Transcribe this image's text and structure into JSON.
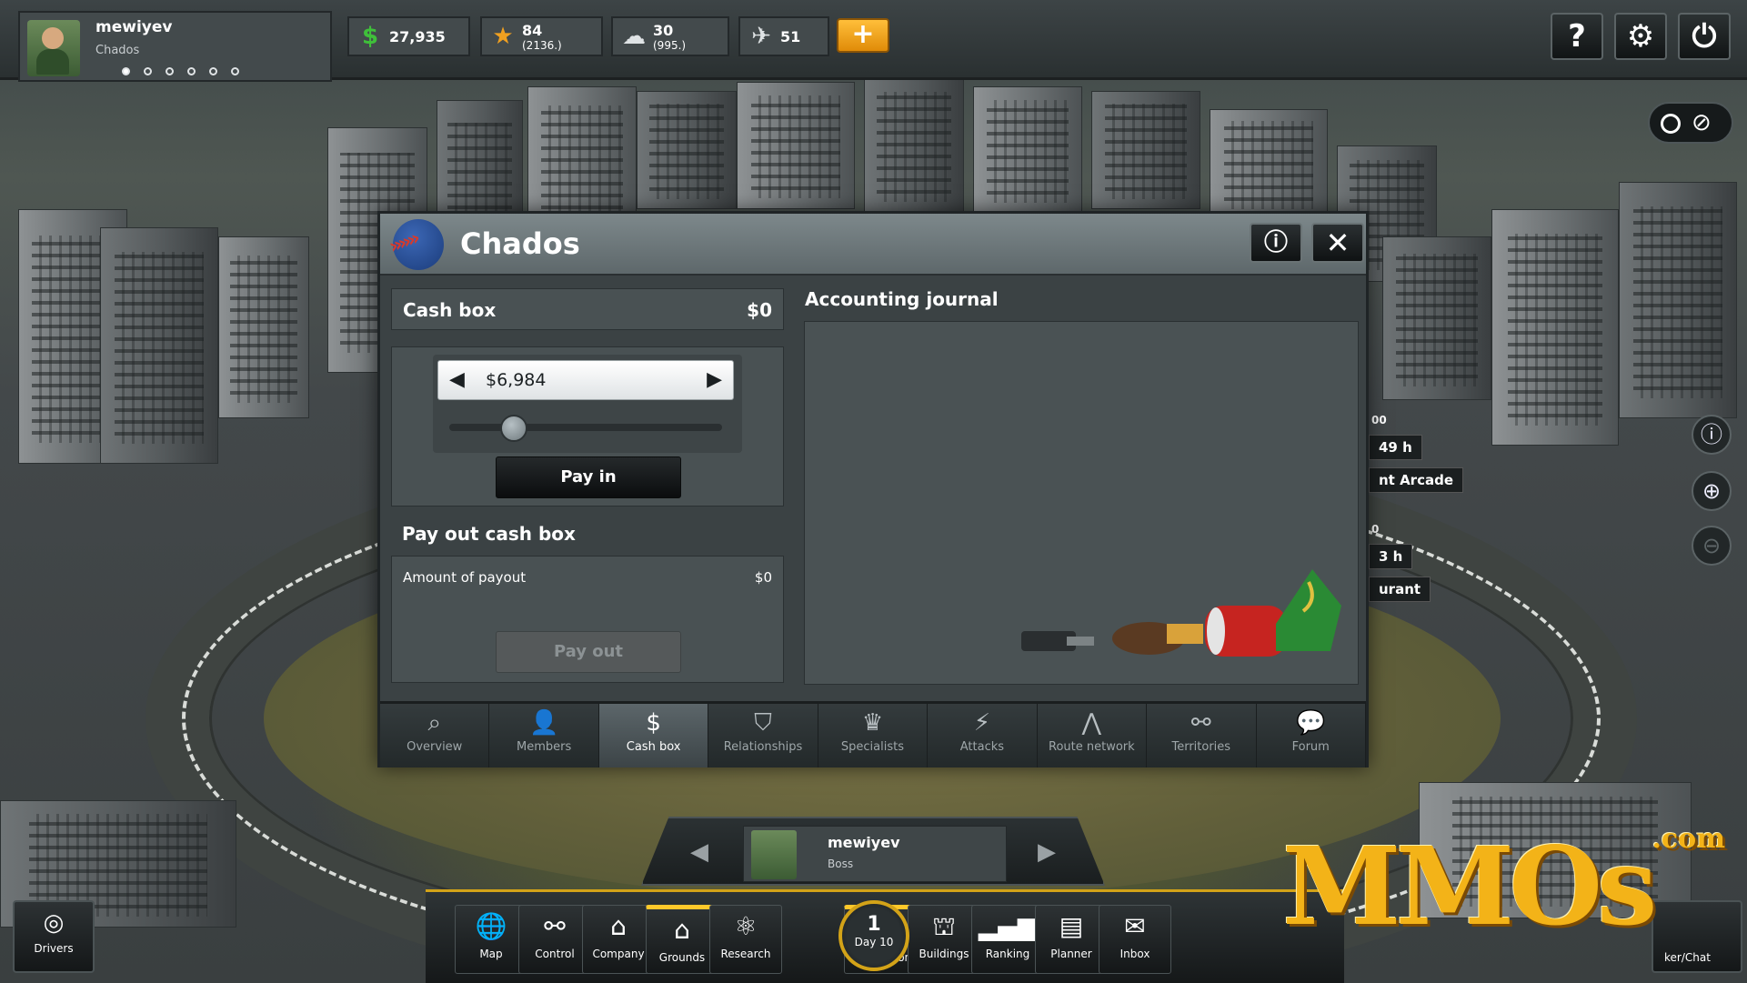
{
  "player": {
    "name": "mewiyev",
    "gang": "Chados",
    "dots": 6,
    "active_dot": 0
  },
  "resources": [
    {
      "icon": "dollar-icon",
      "glyph": "$",
      "color": "#3fbf3a",
      "value": "27,935",
      "sub": ""
    },
    {
      "icon": "star-icon",
      "glyph": "★",
      "color": "#f0a020",
      "value": "84",
      "sub": "(2136.)"
    },
    {
      "icon": "brain-icon",
      "glyph": "☁",
      "color": "#dfe3e5",
      "value": "30",
      "sub": "(995.)"
    },
    {
      "icon": "weapon-icon",
      "glyph": "✈",
      "color": "#dfe3e5",
      "value": "51",
      "sub": ""
    }
  ],
  "top_buttons": {
    "plus": "+",
    "help": "?",
    "settings": "⚙",
    "power": "⏻"
  },
  "map_labels": [
    "00",
    "49 h",
    "nt Arcade",
    "0",
    "3 h",
    "urant"
  ],
  "panel": {
    "title": "Chados",
    "info": "i",
    "close": "✕",
    "cash_box": {
      "label": "Cash box",
      "value": "$0"
    },
    "pay_in": {
      "amount": "$6,984",
      "slider_fraction": 0.2,
      "button": "Pay in"
    },
    "pay_out": {
      "title": "Pay out cash box",
      "amount_label": "Amount of payout",
      "amount_value": "$0",
      "button": "Pay out"
    },
    "journal": {
      "title": "Accounting journal"
    },
    "tabs": [
      {
        "id": "overview",
        "label": "Overview",
        "glyph": "⌕",
        "active": false
      },
      {
        "id": "members",
        "label": "Members",
        "glyph": "👤",
        "active": false
      },
      {
        "id": "cash-box",
        "label": "Cash box",
        "glyph": "$",
        "active": true
      },
      {
        "id": "relationships",
        "label": "Relationships",
        "glyph": "⛉",
        "active": false
      },
      {
        "id": "specialists",
        "label": "Specialists",
        "glyph": "♛",
        "active": false
      },
      {
        "id": "attacks",
        "label": "Attacks",
        "glyph": "⚡",
        "active": false
      },
      {
        "id": "route-network",
        "label": "Route network",
        "glyph": "⋀",
        "active": false
      },
      {
        "id": "territories",
        "label": "Territories",
        "glyph": "⚯",
        "active": false
      },
      {
        "id": "forum",
        "label": "Forum",
        "glyph": "💬",
        "active": false
      }
    ]
  },
  "boss": {
    "name": "mewiyev",
    "role": "Boss"
  },
  "dock": [
    {
      "label": "Map",
      "glyph": "🌐",
      "hl": false
    },
    {
      "label": "Control",
      "glyph": "⚯",
      "hl": false
    },
    {
      "label": "Company",
      "glyph": "⌂",
      "hl": false
    },
    {
      "label": "Grounds",
      "glyph": "⌂",
      "hl": true
    },
    {
      "label": "Research",
      "glyph": "⚛",
      "hl": false
    },
    {
      "label": "Association",
      "glyph": "⛉",
      "hl": true
    },
    {
      "label": "Buildings",
      "glyph": "⛫",
      "hl": false
    },
    {
      "label": "Ranking",
      "glyph": "▂▄▆",
      "hl": false
    },
    {
      "label": "Planner",
      "glyph": "▤",
      "hl": false
    },
    {
      "label": "Inbox",
      "glyph": "✉",
      "hl": false
    }
  ],
  "clock": {
    "day_num": "1",
    "day_label": "Day 10"
  },
  "drivers": {
    "label": "Drivers",
    "glyph": "◎"
  },
  "chat": {
    "label": "ker/Chat"
  },
  "watermark": {
    "text": "MMOs",
    "suffix": ".com"
  }
}
